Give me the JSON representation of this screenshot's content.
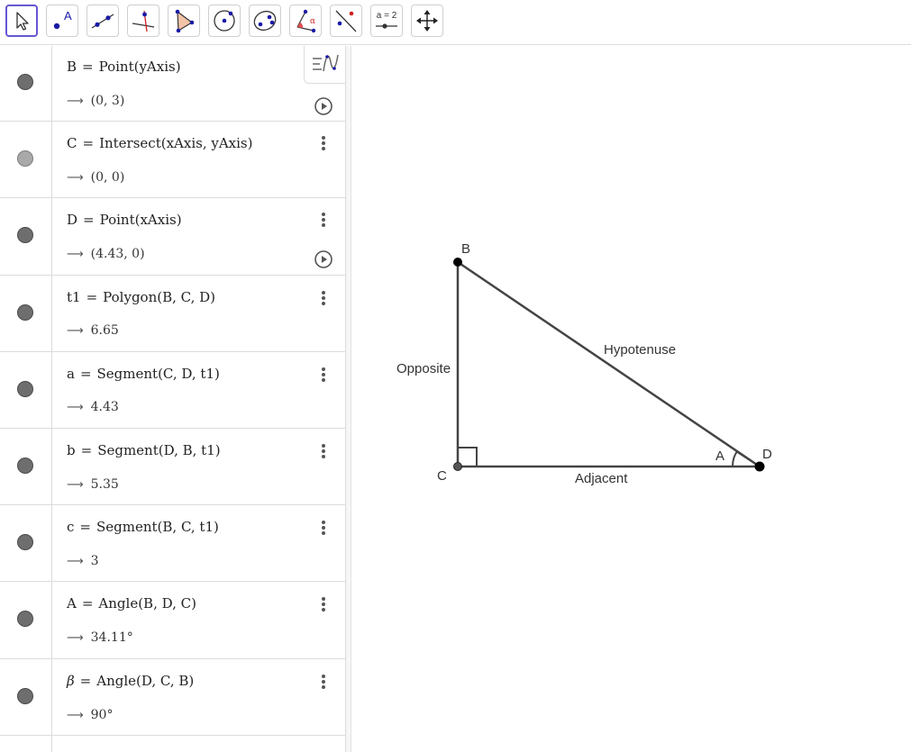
{
  "toolbar": {
    "tools": [
      {
        "name": "move-tool",
        "label": ""
      },
      {
        "name": "point-tool",
        "label": "A"
      },
      {
        "name": "line-tool",
        "label": ""
      },
      {
        "name": "perpendicular-line-tool",
        "label": ""
      },
      {
        "name": "polygon-tool",
        "label": ""
      },
      {
        "name": "circle-center-point-tool",
        "label": ""
      },
      {
        "name": "ellipse-tool",
        "label": ""
      },
      {
        "name": "angle-tool",
        "label": ""
      },
      {
        "name": "reflect-tool",
        "label": ""
      },
      {
        "name": "slider-tool",
        "label": "a = 2"
      },
      {
        "name": "move-graphics-view-tool",
        "label": ""
      }
    ],
    "active_tool": "move-tool"
  },
  "algebra": {
    "rows": [
      {
        "name": "B",
        "eq": "=",
        "def": "Point(yAxis)",
        "value": "(0, 3)",
        "has_play": true,
        "marble": "dark"
      },
      {
        "name": "C",
        "eq": "=",
        "def": "Intersect(xAxis, yAxis)",
        "value": "(0, 0)",
        "has_play": false,
        "marble": "light"
      },
      {
        "name": "D",
        "eq": "=",
        "def": "Point(xAxis)",
        "value": "(4.43, 0)",
        "has_play": true,
        "marble": "dark"
      },
      {
        "name": "t1",
        "eq": "=",
        "def": "Polygon(B, C, D)",
        "value": "6.65",
        "has_play": false,
        "marble": "dark"
      },
      {
        "name": "a",
        "eq": "=",
        "def": "Segment(C, D, t1)",
        "value": "4.43",
        "has_play": false,
        "marble": "dark"
      },
      {
        "name": "b",
        "eq": "=",
        "def": "Segment(D, B, t1)",
        "value": "5.35",
        "has_play": false,
        "marble": "dark"
      },
      {
        "name": "c",
        "eq": "=",
        "def": "Segment(B, C, t1)",
        "value": "3",
        "has_play": false,
        "marble": "dark"
      },
      {
        "name": "A",
        "eq": "=",
        "def": "Angle(B, D, C)",
        "value": "34.11°",
        "has_play": false,
        "marble": "dark"
      },
      {
        "name": "β",
        "eq": "=",
        "def": "Angle(D, C, B)",
        "value": "90°",
        "has_play": false,
        "marble": "dark"
      }
    ],
    "arrow": "⟶"
  },
  "graphics": {
    "point_labels": {
      "B": "B",
      "C": "C",
      "D": "D",
      "A": "A"
    },
    "side_labels": {
      "opposite": "Opposite",
      "hypotenuse": "Hypotenuse",
      "adjacent": "Adjacent"
    },
    "colors": {
      "segment": "#444444",
      "point": "#000000",
      "angle_fill": "#ffffff"
    }
  }
}
